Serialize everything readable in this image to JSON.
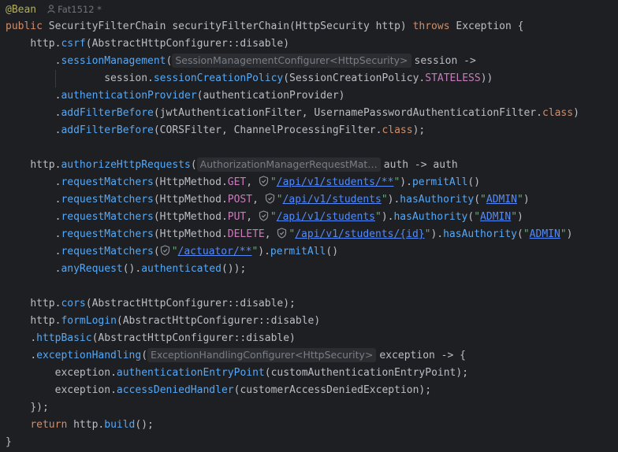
{
  "colors": {
    "background": "#1e1f22",
    "keyword": "#cf8e6d",
    "method": "#56a8f5",
    "string": "#6aab73",
    "url": "#548af7",
    "constant": "#c77dbb",
    "annotation": "#b3ae60",
    "hint_bg": "#2b2d30"
  },
  "meta": {
    "author": "Fat1512 *"
  },
  "code": {
    "l1_ann": "@Bean",
    "l2": {
      "kw": "public",
      "sig": "SecurityFilterChain securityFilterChain(HttpSecurity http)",
      "throws": "throws",
      "exc": "Exception {"
    },
    "l3": {
      "pre": "http.",
      "m": "csrf",
      "rest": "(AbstractHttpConfigurer::disable)"
    },
    "l4": {
      "pre": ".",
      "m": "sessionManagement",
      "open": "(",
      "hint": "SessionManagementConfigurer<HttpSecurity>",
      "rest": "session ->"
    },
    "l5": {
      "pre": "session.",
      "m": "sessionCreationPolicy",
      "mid": "(SessionCreationPolicy.",
      "const": "STATELESS",
      "rest": "))"
    },
    "l6": {
      "pre": ".",
      "m": "authenticationProvider",
      "rest": "(authenticationProvider)"
    },
    "l7": {
      "pre": ".",
      "m": "addFilterBefore",
      "rest": "(jwtAuthenticationFilter, UsernamePasswordAuthenticationFilter.",
      "kw": "class",
      "end": ")"
    },
    "l8": {
      "pre": ".",
      "m": "addFilterBefore",
      "rest": "(CORSFilter, ChannelProcessingFilter.",
      "kw": "class",
      "end": ");"
    },
    "l10": {
      "pre": "http.",
      "m": "authorizeHttpRequests",
      "open": "(",
      "hint": "AuthorizationManagerRequestMat…",
      "rest": "auth -> auth"
    },
    "l11": {
      "pre": ".",
      "m": "requestMatchers",
      "mid": "(HttpMethod.",
      "const": "GET",
      "sep": ", ",
      "q1": "\"",
      "url": "/api/v1/students/**",
      "q2": "\"",
      "rest": ").",
      "m2": "permitAll",
      "end": "()"
    },
    "l12": {
      "pre": ".",
      "m": "requestMatchers",
      "mid": "(HttpMethod.",
      "const": "POST",
      "sep": ", ",
      "q1": "\"",
      "url": "/api/v1/students",
      "q2": "\"",
      "rest": ").",
      "m2": "hasAuthority",
      "open2": "(",
      "s": "\"",
      "arg": "ADMIN",
      "s2": "\"",
      "end": ")"
    },
    "l13": {
      "pre": ".",
      "m": "requestMatchers",
      "mid": "(HttpMethod.",
      "const": "PUT",
      "sep": ", ",
      "q1": "\"",
      "url": "/api/v1/students",
      "q2": "\"",
      "rest": ").",
      "m2": "hasAuthority",
      "open2": "(",
      "s": "\"",
      "arg": "ADMIN",
      "s2": "\"",
      "end": ")"
    },
    "l14": {
      "pre": ".",
      "m": "requestMatchers",
      "mid": "(HttpMethod.",
      "const": "DELETE",
      "sep": ", ",
      "q1": "\"",
      "url": "/api/v1/students/{id}",
      "q2": "\"",
      "rest": ").",
      "m2": "hasAuthority",
      "open2": "(",
      "s": "\"",
      "arg": "ADMIN",
      "s2": "\"",
      "end": ")"
    },
    "l15": {
      "pre": ".",
      "m": "requestMatchers",
      "open": "(",
      "q1": "\"",
      "url": "/actuator/**",
      "q2": "\"",
      "rest": ").",
      "m2": "permitAll",
      "end": "()"
    },
    "l16": {
      "pre": ".",
      "m": "anyRequest",
      "mid": "().",
      "m2": "authenticated",
      "end": "());"
    },
    "l18": {
      "pre": "http.",
      "m": "cors",
      "rest": "(AbstractHttpConfigurer::disable);"
    },
    "l19": {
      "pre": "http.",
      "m": "formLogin",
      "rest": "(AbstractHttpConfigurer::disable)"
    },
    "l20": {
      "pre": ".",
      "m": "httpBasic",
      "rest": "(AbstractHttpConfigurer::disable)"
    },
    "l21": {
      "pre": ".",
      "m": "exceptionHandling",
      "open": "(",
      "hint": "ExceptionHandlingConfigurer<HttpSecurity>",
      "rest": "exception -> {"
    },
    "l22": {
      "pre": "exception.",
      "m": "authenticationEntryPoint",
      "rest": "(customAuthenticationEntryPoint);"
    },
    "l23": {
      "pre": "exception.",
      "m": "accessDeniedHandler",
      "rest": "(customerAccessDeniedException);"
    },
    "l24": "});",
    "l25": {
      "kw": "return",
      "pre": " http.",
      "m": "build",
      "rest": "();"
    },
    "l26": "}"
  }
}
